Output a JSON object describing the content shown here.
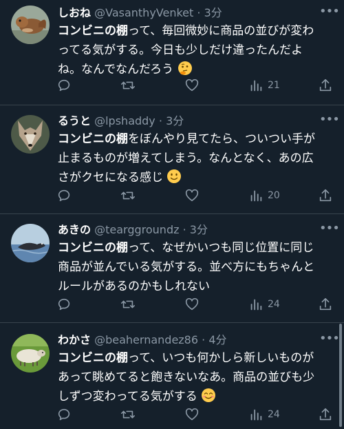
{
  "tweets": [
    {
      "name": "しおね",
      "handle": "@VasanthyVenket",
      "dot": "·",
      "time": "3分",
      "keyword": "コンビニの棚",
      "text_lines": [
        "って、毎回微妙に商品の並びが変わ",
        "ってる気がする。今日も少しだけ違ったんだよ",
        "ね。なんでなんだろう"
      ],
      "emoji": "thinking-face",
      "views": "21",
      "avatar": "squirrel"
    },
    {
      "name": "るうと",
      "handle": "@lpshaddy",
      "dot": "·",
      "time": "3分",
      "keyword": "コンビニの棚",
      "text_lines": [
        "をぼんやり見てたら、ついつい手が",
        "止まるものが増えてしまう。なんとなく、あの広",
        "さがクセになる感じ"
      ],
      "emoji": "slightly-smiling-face",
      "views": "20",
      "avatar": "wolf"
    },
    {
      "name": "あきの",
      "handle": "@tearggroundz",
      "dot": "·",
      "time": "3分",
      "keyword": "コンビニの棚",
      "text_lines": [
        "って、なぜかいつも同じ位置に同じ",
        "商品が並んでいる気がする。並べ方にもちゃんと",
        "ルールがあるのかもしれない"
      ],
      "emoji": "",
      "views": "24",
      "avatar": "seal"
    },
    {
      "name": "わかさ",
      "handle": "@beahernandez86",
      "dot": "·",
      "time": "4分",
      "keyword": "コンビニの棚",
      "text_lines": [
        "って、いつも何かしら新しいものが",
        "あって眺めてると飽きないなあ。商品の並びも少",
        "しずつ変わってる気がする"
      ],
      "emoji": "smiling-face-with-smiling-eyes",
      "views": "24",
      "avatar": "sheep"
    }
  ],
  "icons": {
    "reply": "reply-icon",
    "retweet": "retweet-icon",
    "like": "heart-icon",
    "views": "views-icon",
    "share": "share-icon",
    "more": "more-icon"
  },
  "colors": {
    "background": "#15202b",
    "divider": "#38444d",
    "secondary_text": "#8b98a5",
    "primary_text": "#ffffff"
  }
}
